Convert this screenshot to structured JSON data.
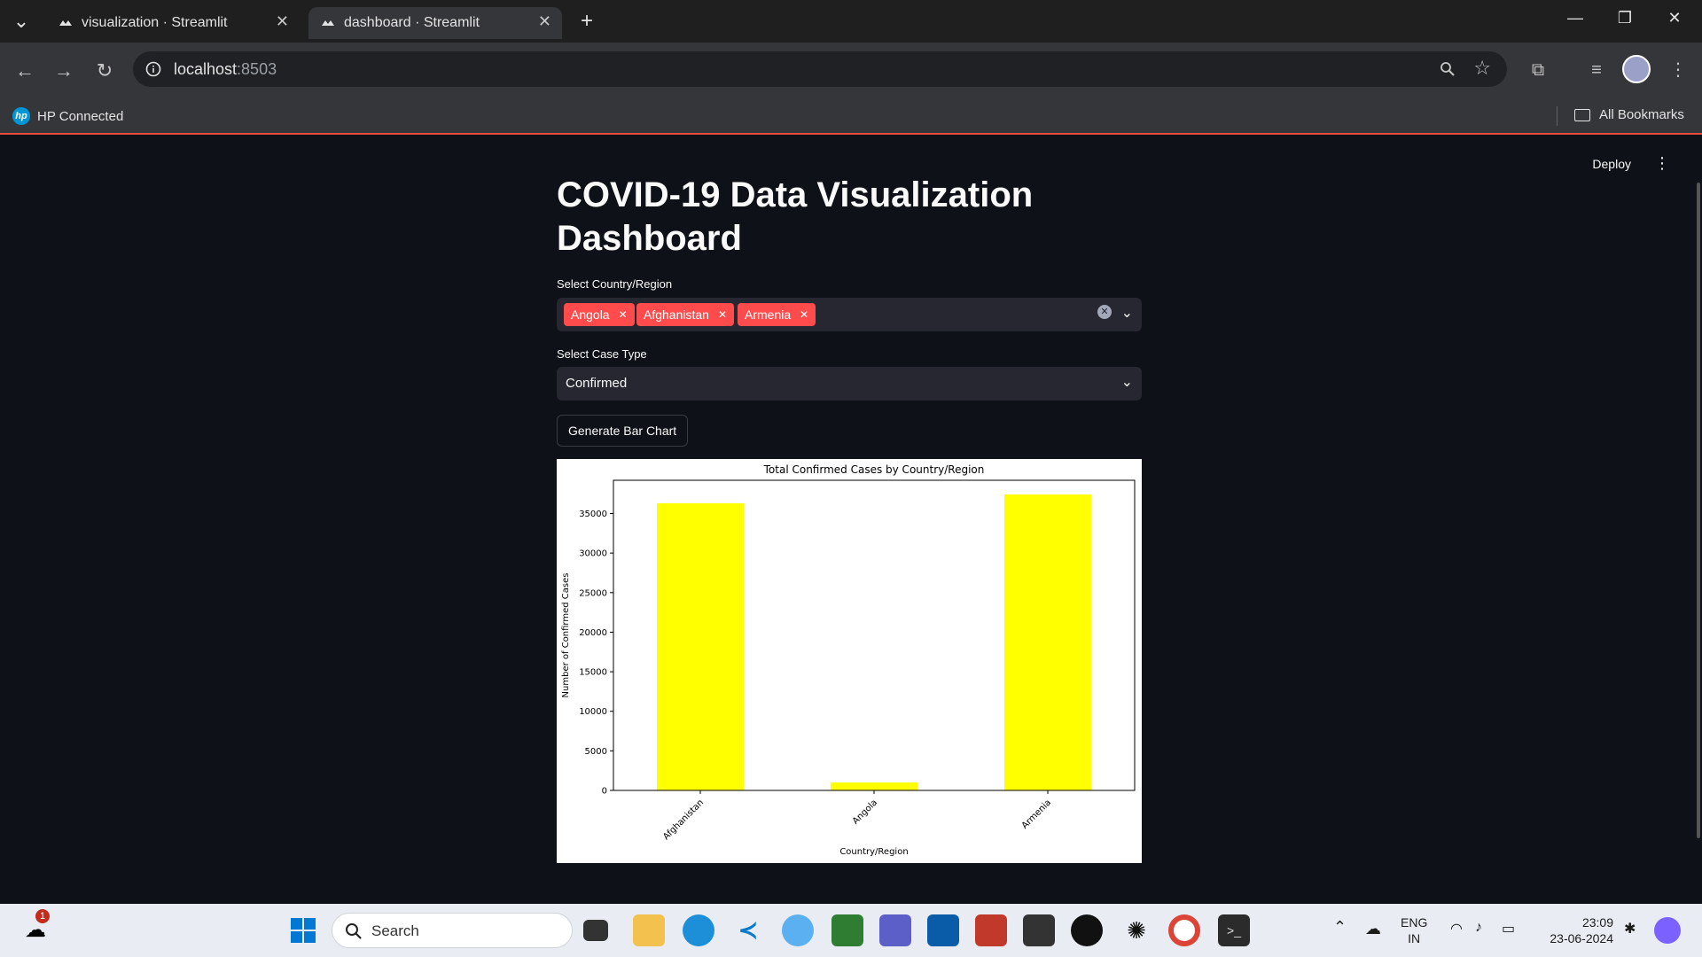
{
  "browser": {
    "tabs": [
      {
        "label": "visualization · Streamlit",
        "active": false
      },
      {
        "label": "dashboard · Streamlit",
        "active": true
      }
    ],
    "new_tab_symbol": "+",
    "url_host": "localhost",
    "url_port": ":8503",
    "bookmarks": {
      "left": "HP Connected",
      "right": "All Bookmarks"
    }
  },
  "app": {
    "deploy_label": "Deploy",
    "title": "COVID-19 Data Visualization Dashboard",
    "country_label": "Select Country/Region",
    "selected_countries": [
      "Angola",
      "Afghanistan",
      "Armenia"
    ],
    "case_type_label": "Select Case Type",
    "case_type_value": "Confirmed",
    "generate_button": "Generate Bar Chart"
  },
  "chart_data": {
    "type": "bar",
    "title": "Total Confirmed Cases by Country/Region",
    "xlabel": "Country/Region",
    "ylabel": "Number of Confirmed Cases",
    "categories": [
      "Afghanistan",
      "Angola",
      "Armenia"
    ],
    "values": [
      36300,
      1000,
      37400
    ],
    "ylim": [
      0,
      39200
    ],
    "yticks": [
      0,
      5000,
      10000,
      15000,
      20000,
      25000,
      30000,
      35000
    ],
    "bar_color": "#ffff00",
    "grid": false
  },
  "taskbar": {
    "search_placeholder": "Search",
    "weather_badge": "1",
    "lang_line1": "ENG",
    "lang_line2": "IN",
    "time": "23:09",
    "date": "23-06-2024"
  }
}
